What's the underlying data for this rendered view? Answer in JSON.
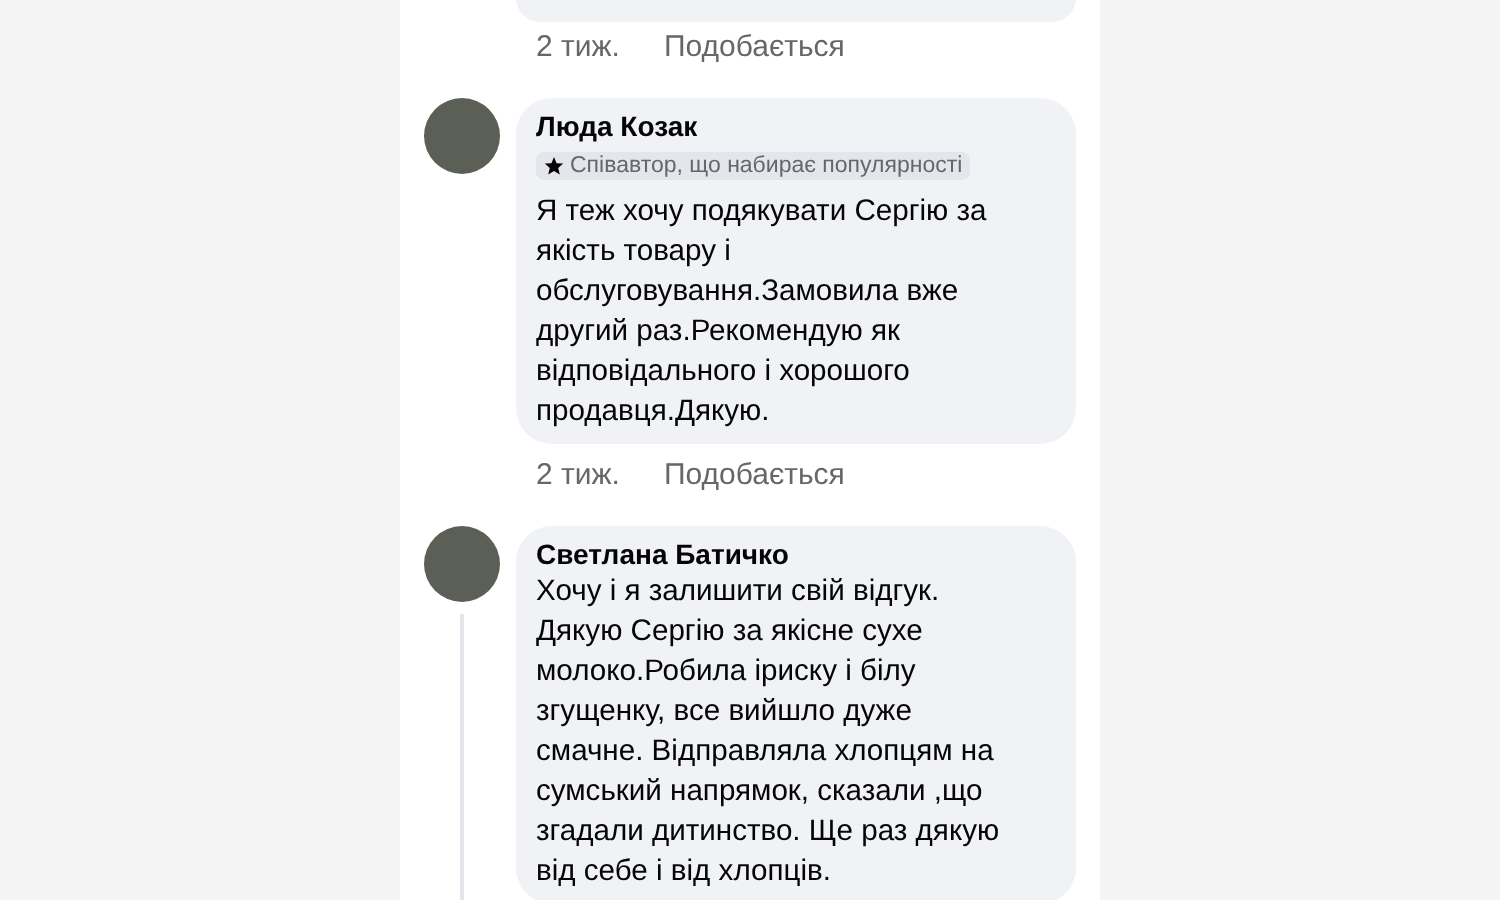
{
  "comments": [
    {
      "kind": "partial",
      "time": "2 тиж.",
      "like": "Подобається"
    },
    {
      "kind": "full",
      "author": "Люда Козак",
      "badge": "Співавтор, що набирає популярності",
      "text": "Я теж хочу подякувати Сергію за якість товару і обслуговування.Замовила вже другий раз.Рекомендую як відповідального і хорошого продавця.Дякую.",
      "time": "2 тиж.",
      "like": "Подобається",
      "thread": false
    },
    {
      "kind": "full",
      "author": "Светлана Батичко",
      "text": "Хочу і я залишити свій відгук. Дякую Сергію за якісне сухе молоко.Робила іриску і білу згущенку, все вийшло дуже смачне. Відправляла хлопцям на сумський напрямок, сказали ,що згадали дитинство. Ще раз дякую від себе і від хлопців.",
      "thread": true
    }
  ]
}
